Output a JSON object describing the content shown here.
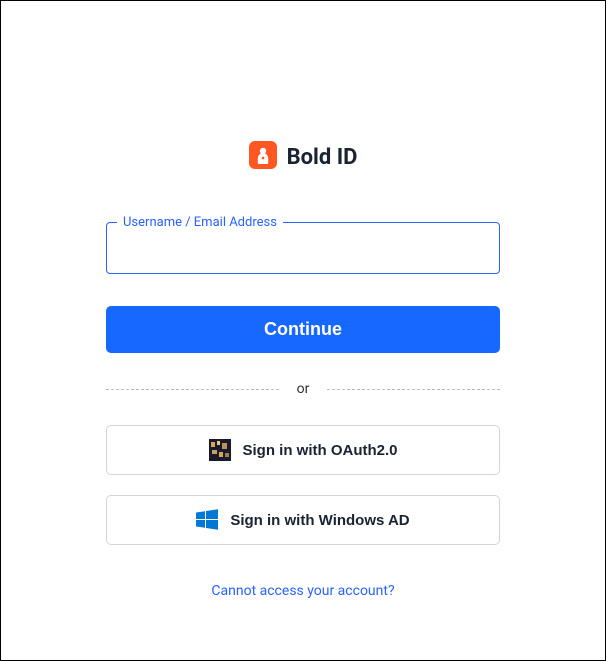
{
  "logo": {
    "text": "Bold ID"
  },
  "form": {
    "username_label": "Username / Email Address",
    "username_value": "",
    "continue_label": "Continue",
    "divider_text": "or",
    "oauth_label": "Sign in with OAuth2.0",
    "windows_label": "Sign in with Windows AD",
    "cannot_access_label": "Cannot access your account?"
  },
  "colors": {
    "primary": "#1768ff",
    "accent": "#ff5722",
    "text": "#1a2332"
  }
}
